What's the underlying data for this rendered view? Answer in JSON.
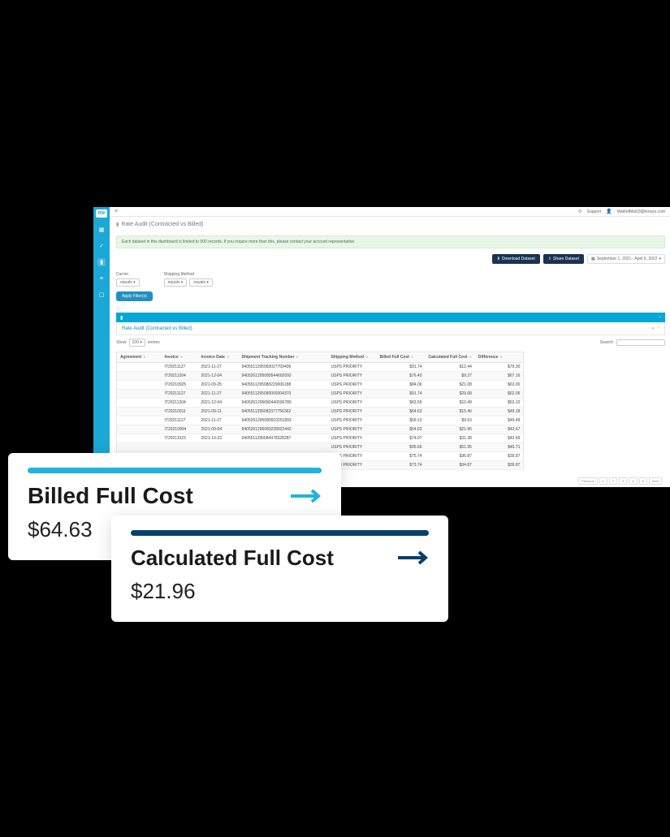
{
  "header": {
    "logo_text": "RW",
    "support_label": "Support",
    "user_email": "MadridMat18@lensys.com"
  },
  "breadcrumb": {
    "title": "Rate Audit (Contracted vs Billed)"
  },
  "banner": {
    "text": "Each dataset in this dashboard is limited to 500 records. If you require more than this, please contact your account representative."
  },
  "toolbar": {
    "download_label": "Download Dataset",
    "share_label": "Share Dataset",
    "date_range": "September 1, 2021 - April 6, 2022"
  },
  "filters": {
    "carrier_label": "Carrier",
    "shipping_label": "Shipping Method",
    "equals": "equals",
    "apply_label": "Apply Filter(s)"
  },
  "panel": {
    "subtitle": "Rate Audit (Contracted vs Billed)",
    "show_label": "Show",
    "entries_value": "100",
    "entries_label": "entries",
    "search_label": "Search:"
  },
  "columns": {
    "agreement": "Agreement",
    "invoice": "Invoice",
    "invoice_date": "Invoice Date",
    "tracking": "Shipment Tracking Number",
    "shipping_method": "Shipping Method",
    "billed_full_cost": "Billed Full Cost",
    "calculated_full_cost": "Calculated Full Cost",
    "difference": "Difference"
  },
  "rows": [
    {
      "agreement": "",
      "invoice": "IT20211127",
      "date": "2021-11-27",
      "tracking": "9405511295083027709406",
      "ship": "USPS PRIORITY",
      "billed": "$91.74",
      "calc": "$12.44",
      "diff": "$79.30"
    },
    {
      "agreement": "",
      "invoice": "IT20211204",
      "date": "2021-12-04",
      "tracking": "9405261295080544602092",
      "ship": "USPS PRIORITY",
      "billed": "$76.40",
      "calc": "$9.27",
      "diff": "$67.16"
    },
    {
      "agreement": "",
      "invoice": "IT20210925",
      "date": "2021-09-25",
      "tracking": "9405511295080229006188",
      "ship": "USPS PRIORITY",
      "billed": "$84.06",
      "calc": "$21.08",
      "diff": "$63.00"
    },
    {
      "agreement": "",
      "invoice": "IT20211127",
      "date": "2021-11-27",
      "tracking": "9405511295080009304370",
      "ship": "USPS PRIORITY",
      "billed": "$91.74",
      "calc": "$29.68",
      "diff": "$62.06"
    },
    {
      "agreement": "",
      "invoice": "IT20211204",
      "date": "2021-12-04",
      "tracking": "9405261295080440036789",
      "ship": "USPS PRIORITY",
      "billed": "$63.59",
      "calc": "$10.49",
      "diff": "$53.10"
    },
    {
      "agreement": "",
      "invoice": "IT20210911",
      "date": "2021-09-11",
      "tracking": "9405511295082377756362",
      "ship": "USPS PRIORITY",
      "billed": "$64.63",
      "calc": "$15.46",
      "diff": "$49.18"
    },
    {
      "agreement": "",
      "invoice": "IT20211127",
      "date": "2021-11-27",
      "tracking": "9405261295080910251893",
      "ship": "USPS PRIORITY",
      "billed": "$59.13",
      "calc": "$9.63",
      "diff": "$49.49"
    },
    {
      "agreement": "",
      "invoice": "IT20210904",
      "date": "2021-09-04",
      "tracking": "9405261295083228922442",
      "ship": "USPS PRIORITY",
      "billed": "$64.63",
      "calc": "$21.96",
      "diff": "$42.67"
    },
    {
      "agreement": "",
      "invoice": "IT20211023",
      "date": "2021-10-23",
      "tracking": "9405511295084478328287",
      "ship": "USPS PRIORITY",
      "billed": "$74.07",
      "calc": "$31.38",
      "diff": "$42.69"
    },
    {
      "agreement": "",
      "invoice": "",
      "date": "",
      "tracking": "",
      "ship": "USPS PRIORITY",
      "billed": "$95.66",
      "calc": "$51.95",
      "diff": "$40.71"
    },
    {
      "agreement": "",
      "invoice": "",
      "date": "",
      "tracking": "",
      "ship": "USPS PRIORITY",
      "billed": "$75.74",
      "calc": "$36.87",
      "diff": "$39.87"
    },
    {
      "agreement": "",
      "invoice": "",
      "date": "",
      "tracking": "",
      "ship": "USPS PRIORITY",
      "billed": "$73.74",
      "calc": "$34.87",
      "diff": "$39.87"
    }
  ],
  "pagination": {
    "previous": "Previous",
    "next": "Next",
    "pages": [
      "1",
      "2",
      "3",
      "4",
      "5"
    ]
  },
  "callouts": {
    "billed": {
      "title": "Billed Full Cost",
      "value": "$64.63"
    },
    "calculated": {
      "title": "Calculated Full Cost",
      "value": "$21.96"
    }
  }
}
